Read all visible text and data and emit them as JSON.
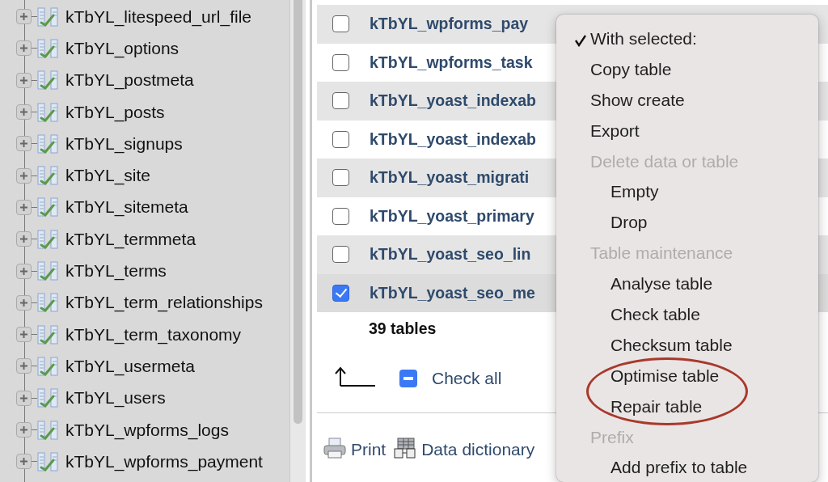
{
  "sidebar": {
    "tables": [
      {
        "name": "kTbYL_litespeed_url_file"
      },
      {
        "name": "kTbYL_options"
      },
      {
        "name": "kTbYL_postmeta"
      },
      {
        "name": "kTbYL_posts"
      },
      {
        "name": "kTbYL_signups"
      },
      {
        "name": "kTbYL_site"
      },
      {
        "name": "kTbYL_sitemeta"
      },
      {
        "name": "kTbYL_termmeta"
      },
      {
        "name": "kTbYL_terms"
      },
      {
        "name": "kTbYL_term_relationships"
      },
      {
        "name": "kTbYL_term_taxonomy"
      },
      {
        "name": "kTbYL_usermeta"
      },
      {
        "name": "kTbYL_users"
      },
      {
        "name": "kTbYL_wpforms_logs"
      },
      {
        "name": "kTbYL_wpforms_payment"
      }
    ]
  },
  "table_list": {
    "rows": [
      {
        "name": "kTbYL_wpforms_pay",
        "checked": false
      },
      {
        "name": "kTbYL_wpforms_task",
        "checked": false
      },
      {
        "name": "kTbYL_yoast_indexab",
        "checked": false
      },
      {
        "name": "kTbYL_yoast_indexab",
        "checked": false
      },
      {
        "name": "kTbYL_yoast_migrati",
        "checked": false
      },
      {
        "name": "kTbYL_yoast_primary",
        "checked": false
      },
      {
        "name": "kTbYL_yoast_seo_lin",
        "checked": false
      },
      {
        "name": "kTbYL_yoast_seo_me",
        "checked": true
      }
    ],
    "summary": "39 tables",
    "check_all": {
      "label": "Check all",
      "mixed": true
    },
    "links": [
      {
        "kind": "print",
        "label": "Print"
      },
      {
        "kind": "dictionary",
        "label": "Data dictionary"
      }
    ]
  },
  "context_menu": {
    "title": {
      "label": "With selected:",
      "checked": true
    },
    "items": [
      {
        "label": "Copy table",
        "disabled": false
      },
      {
        "label": "Show create",
        "disabled": false
      },
      {
        "label": "Export",
        "disabled": false
      },
      {
        "label": "Delete data or table",
        "disabled": true,
        "children": [
          {
            "label": "Empty",
            "circled": false
          },
          {
            "label": "Drop",
            "circled": false
          }
        ]
      },
      {
        "label": "Table maintenance",
        "disabled": true,
        "children": [
          {
            "label": "Analyse table",
            "circled": false
          },
          {
            "label": "Check table",
            "circled": false
          },
          {
            "label": "Checksum table",
            "circled": false
          },
          {
            "label": "Optimise table",
            "circled": true
          },
          {
            "label": "Repair table",
            "circled": true
          }
        ]
      },
      {
        "label": "Prefix",
        "disabled": true,
        "children": [
          {
            "label": "Add prefix to table",
            "circled": false
          }
        ]
      }
    ]
  }
}
